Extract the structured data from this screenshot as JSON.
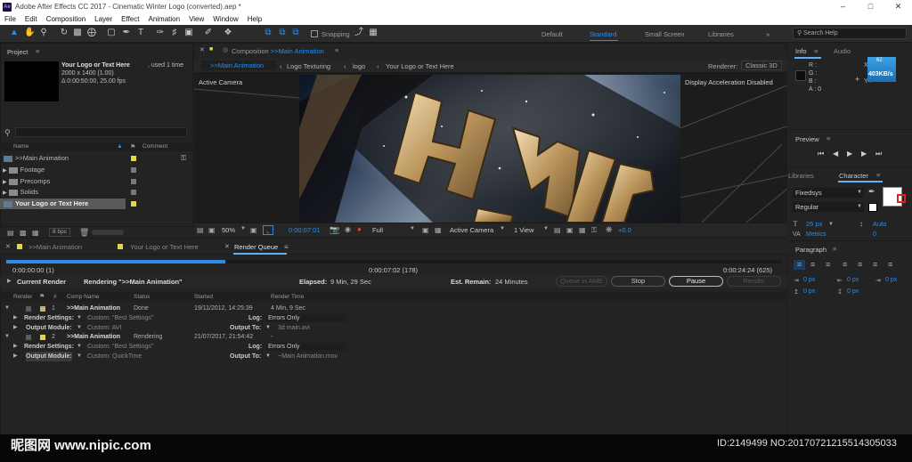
{
  "window": {
    "title": "Adobe After Effects CC 2017 - Cinematic Winter Logo (converted).aep *",
    "app_icon": "Ae"
  },
  "menu": [
    "File",
    "Edit",
    "Composition",
    "Layer",
    "Effect",
    "Animation",
    "View",
    "Window",
    "Help"
  ],
  "toolbar": {
    "snapping": "Snapping",
    "workspaces": [
      "Default",
      "Standard",
      "Small Screen",
      "Libraries"
    ],
    "active_workspace": "Standard",
    "search_placeholder": "Search Help"
  },
  "project": {
    "title": "Project",
    "selected_name": "Your Logo or Text Here",
    "used": ", used 1 time",
    "dims": "2000 x 1400 (1.00)",
    "duration": "Δ 0:00:50:00, 25.00 fps",
    "col_name": "Name",
    "col_comment": "Comment",
    "items": [
      {
        "name": ">>Main Animation",
        "color": "#e6d64a"
      },
      {
        "name": "Footage",
        "color": "#7a7a7a"
      },
      {
        "name": "Precomps",
        "color": "#7a7a7a"
      },
      {
        "name": "Solids",
        "color": "#7a7a7a"
      },
      {
        "name": "Your Logo or Text Here",
        "color": "#e6d64a"
      }
    ],
    "bpc": "8 bpc"
  },
  "composition": {
    "tab_title": "Composition >>Main Animation",
    "crumbs": [
      ">>Main Animation",
      "Logo Texturing",
      "logo",
      "Your Logo or Text Here"
    ],
    "renderer_label": "Renderer:",
    "renderer_value": "Classic 3D",
    "active_camera": "Active Camera",
    "accel": "Display Acceleration Disabled",
    "footer": {
      "zoom": "50%",
      "timecode": "0:00:07:01",
      "resolution": "Full",
      "camera": "Active Camera",
      "views": "1 View",
      "exposure": "+0.0"
    }
  },
  "info": {
    "tab": "Info",
    "tab2": "Audio",
    "R": "R :",
    "G": "G :",
    "B": "B :",
    "A": "A : 0",
    "X": "X :",
    "Y": "Y :",
    "speed": "403KB/s",
    "pct": "62"
  },
  "preview": {
    "title": "Preview"
  },
  "character": {
    "tab1": "Libraries",
    "tab2": "Character",
    "font": "Fixedsys",
    "style": "Regular",
    "size": "26 px",
    "leading": "Auto",
    "kerning": "Metrics",
    "tracking": "0"
  },
  "paragraph": {
    "title": "Paragraph",
    "indent": [
      "0 px",
      "0 px",
      "0 px"
    ],
    "space": [
      "0 px",
      "0 px"
    ]
  },
  "renderqueue": {
    "tabs": [
      ">>Main Animation",
      "Your Logo or Text Here",
      "Render Queue"
    ],
    "time_start": "0:00:00:00 (1)",
    "time_mid": "0:00:07:02 (178)",
    "time_end": "0:00:24:24 (625)",
    "current_render": "Current Render",
    "rendering": "Rendering \">>Main Animation\"",
    "elapsed_label": "Elapsed:",
    "elapsed": "9 Min, 29 Sec",
    "remain_label": "Est. Remain:",
    "remain": "24 Minutes",
    "buttons": {
      "ame": "Queue in AME",
      "stop": "Stop",
      "pause": "Pause",
      "render": "Render"
    },
    "headers": [
      "Render",
      "#",
      "Comp Name",
      "Status",
      "Started",
      "Render Time"
    ],
    "items": [
      {
        "num": "1",
        "comp": ">>Main Animation",
        "status": "Done",
        "started": "19/11/2012, 14:25:39",
        "time": "4 Min, 9 Sec",
        "settings": "Custom: \"Best Settings\"",
        "log": "Errors Only",
        "module": "Custom: AVI",
        "output": "3d main.avi",
        "color": "#c7b07a"
      },
      {
        "num": "2",
        "comp": ">>Main Animation",
        "status": "Rendering",
        "started": "21/07/2017, 21:54:42",
        "time": "-",
        "settings": "Custom: \"Best Settings\"",
        "log": "Errors Only",
        "module": "Custom: QuickTime",
        "output": "~Main Animation.mov",
        "color": "#e6d64a"
      }
    ],
    "labels": {
      "render_settings": "Render Settings:",
      "output_module": "Output Module:",
      "log": "Log:",
      "output_to": "Output To:"
    }
  },
  "watermark": {
    "left": "昵图网 www.nipic.com",
    "right": "ID:2149499 NO:20170721215514305033"
  }
}
